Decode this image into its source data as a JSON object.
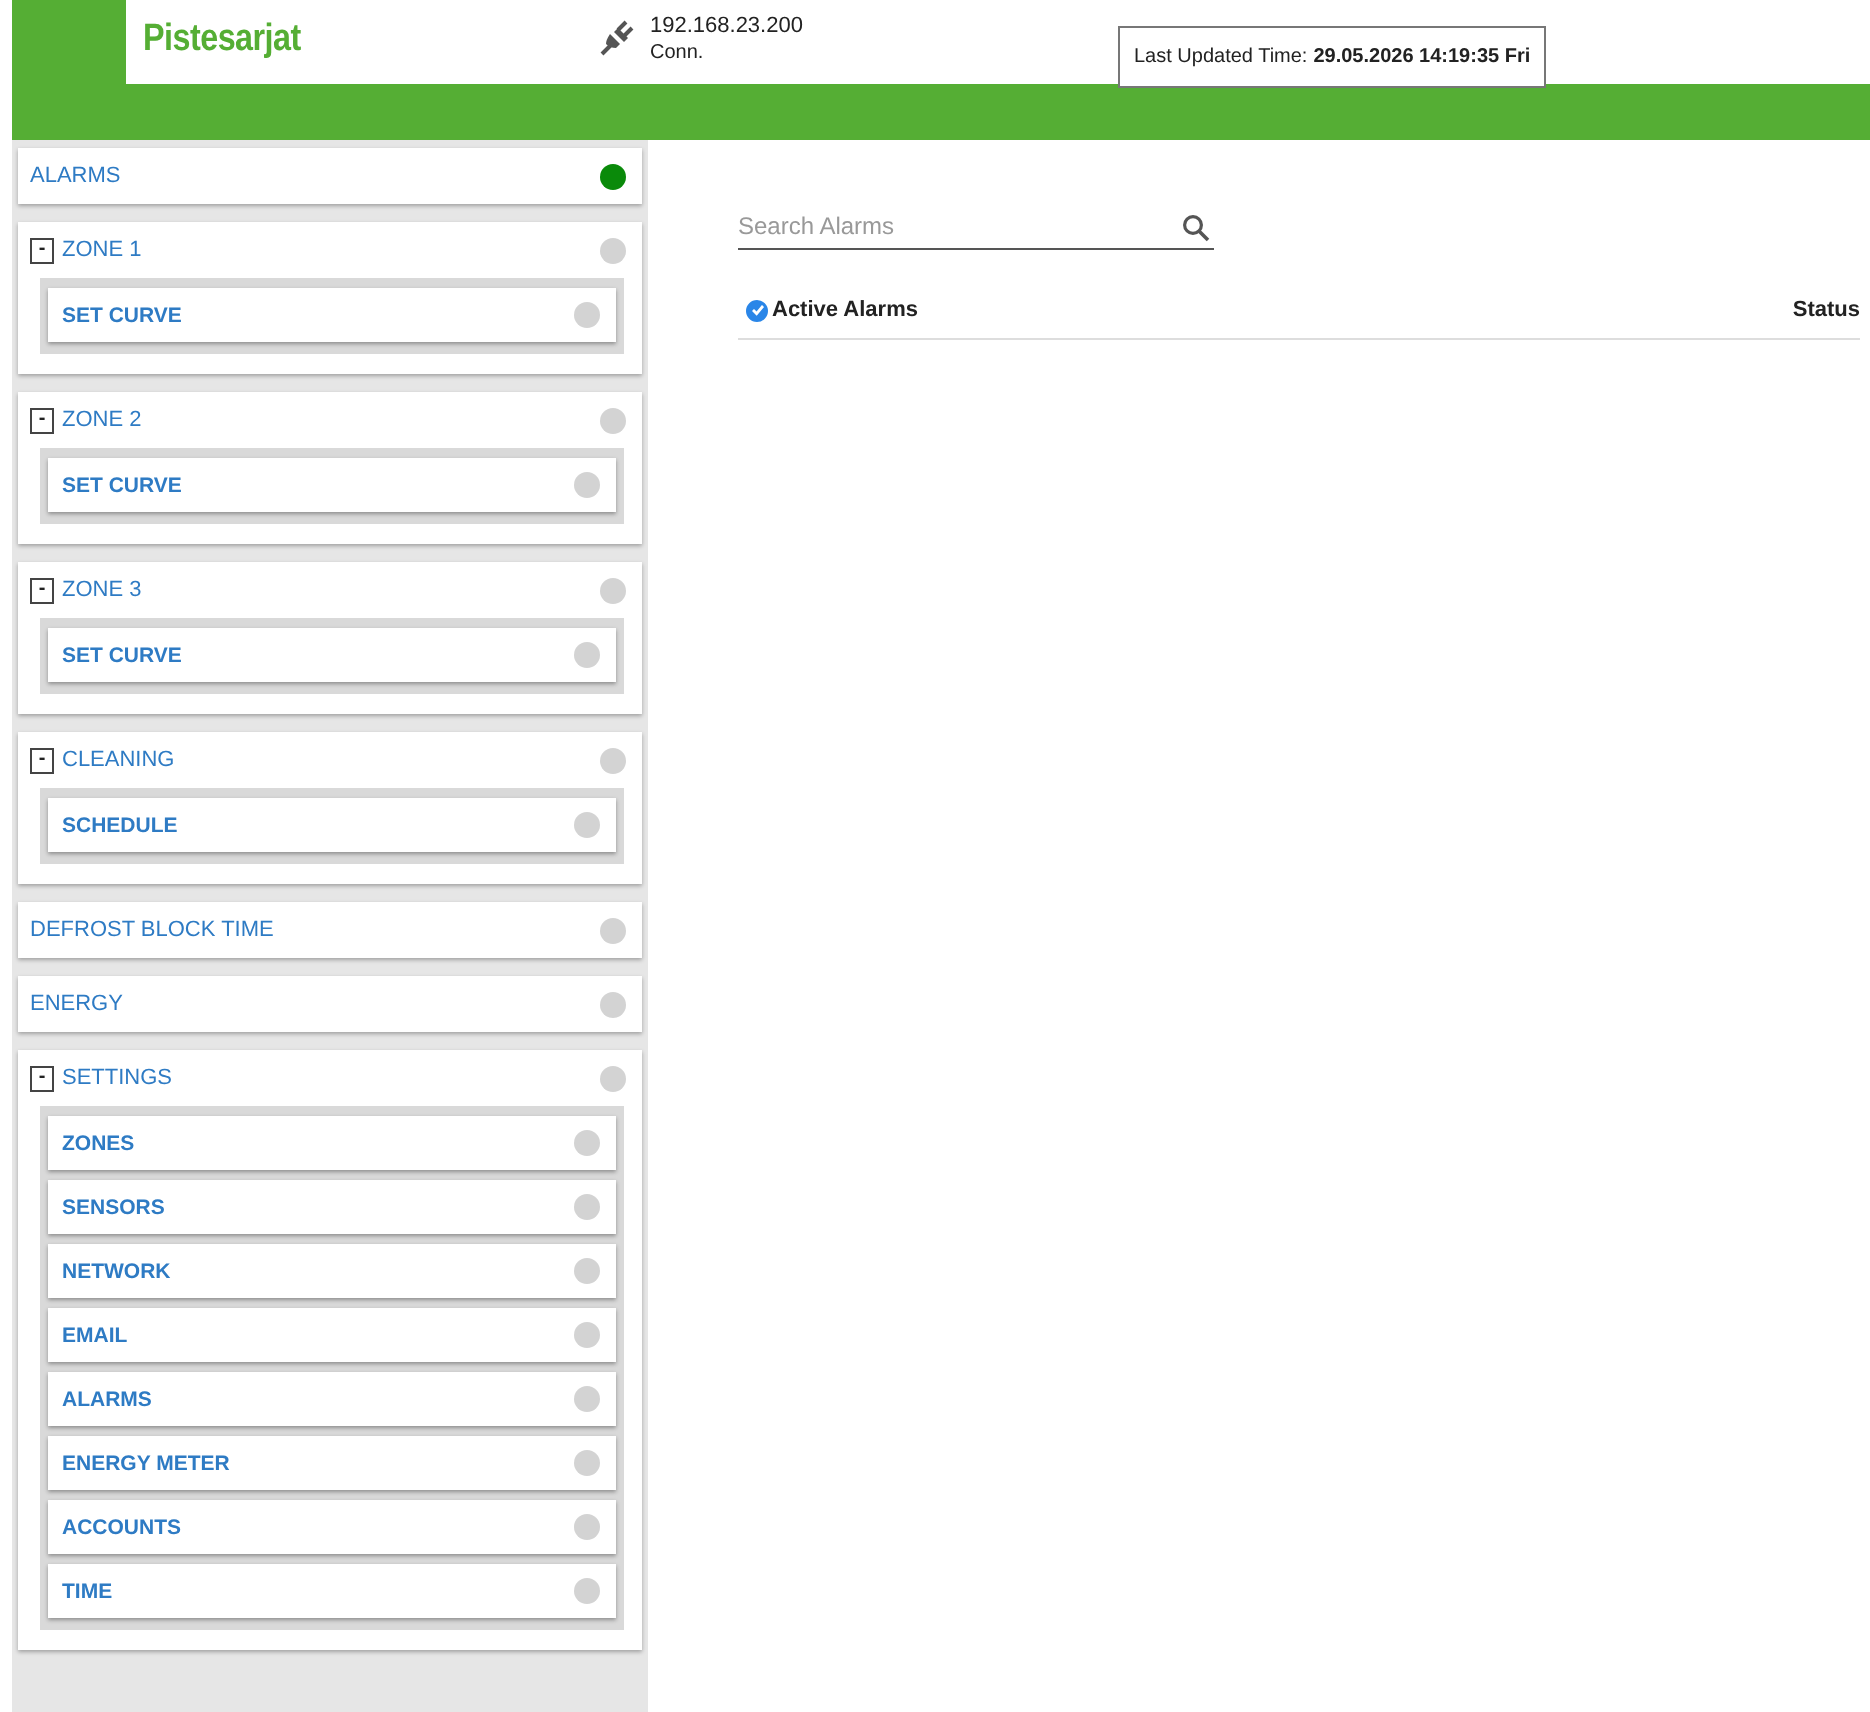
{
  "header": {
    "title": "Pistesarjat",
    "ip": "192.168.23.200",
    "connection": "Conn.",
    "updated_label": "Last Updated Time:",
    "updated_value": "29.05.2026 14:19:35 Fri"
  },
  "sidebar": {
    "items": [
      {
        "label": "ALARMS",
        "color": "#0a8a0a"
      },
      {
        "label": "ZONE 1",
        "color": "#d3d3d3",
        "toggle": "-",
        "expanded": true,
        "children": [
          {
            "label": "SET CURVE",
            "color": "#d3d3d3"
          }
        ]
      },
      {
        "label": "ZONE 2",
        "color": "#d3d3d3",
        "toggle": "-",
        "expanded": true,
        "children": [
          {
            "label": "SET CURVE",
            "color": "#d3d3d3"
          }
        ]
      },
      {
        "label": "ZONE 3",
        "color": "#d3d3d3",
        "toggle": "-",
        "expanded": true,
        "children": [
          {
            "label": "SET CURVE",
            "color": "#d3d3d3"
          }
        ]
      },
      {
        "label": "CLEANING",
        "color": "#d3d3d3",
        "toggle": "-",
        "expanded": true,
        "children": [
          {
            "label": "SCHEDULE",
            "color": "#d3d3d3"
          }
        ]
      },
      {
        "label": "DEFROST BLOCK TIME",
        "color": "#d3d3d3"
      },
      {
        "label": "ENERGY",
        "color": "#d3d3d3"
      },
      {
        "label": "SETTINGS",
        "color": "#d3d3d3",
        "toggle": "-",
        "expanded": true,
        "children": [
          {
            "label": "ZONES",
            "color": "#d3d3d3"
          },
          {
            "label": "SENSORS",
            "color": "#d3d3d3"
          },
          {
            "label": "NETWORK",
            "color": "#d3d3d3"
          },
          {
            "label": "EMAIL",
            "color": "#d3d3d3"
          },
          {
            "label": "ALARMS",
            "color": "#d3d3d3"
          },
          {
            "label": "ENERGY METER",
            "color": "#d3d3d3"
          },
          {
            "label": "ACCOUNTS",
            "color": "#d3d3d3"
          },
          {
            "label": "TIME",
            "color": "#d3d3d3"
          }
        ]
      }
    ]
  },
  "search": {
    "placeholder": "Search Alarms"
  },
  "table": {
    "columns": [
      {
        "label": "Active Alarms",
        "checked": true
      },
      {
        "label": "Status"
      }
    ]
  }
}
